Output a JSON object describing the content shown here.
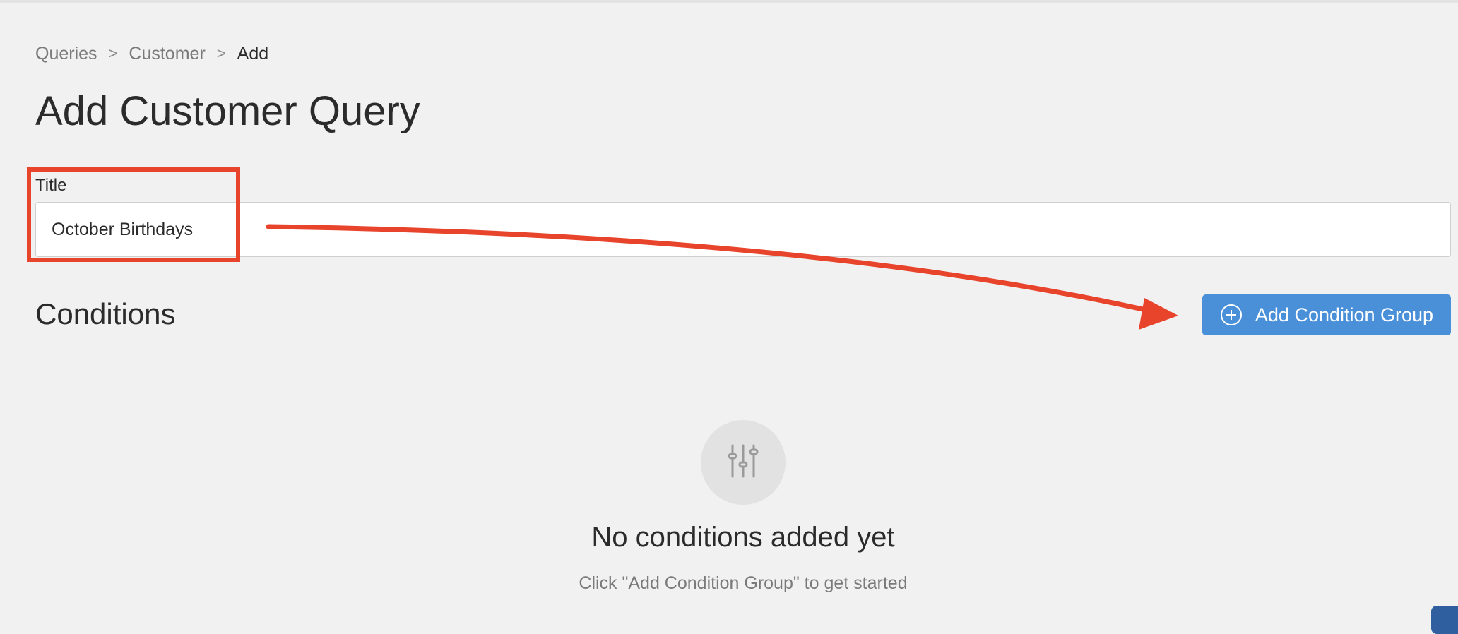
{
  "breadcrumb": {
    "items": [
      "Queries",
      "Customer",
      "Add"
    ],
    "separator": ">"
  },
  "page": {
    "title": "Add Customer Query"
  },
  "form": {
    "title_label": "Title",
    "title_value": "October Birthdays"
  },
  "conditions": {
    "heading": "Conditions",
    "add_button_label": "Add Condition Group",
    "empty_title": "No conditions added yet",
    "empty_hint": "Click \"Add Condition Group\" to get started"
  },
  "icons": {
    "add_button": "plus-circle-icon",
    "empty_state": "sliders-icon"
  },
  "colors": {
    "accent": "#4a90d9",
    "annotation": "#e8432b",
    "background": "#f1f1f1"
  }
}
